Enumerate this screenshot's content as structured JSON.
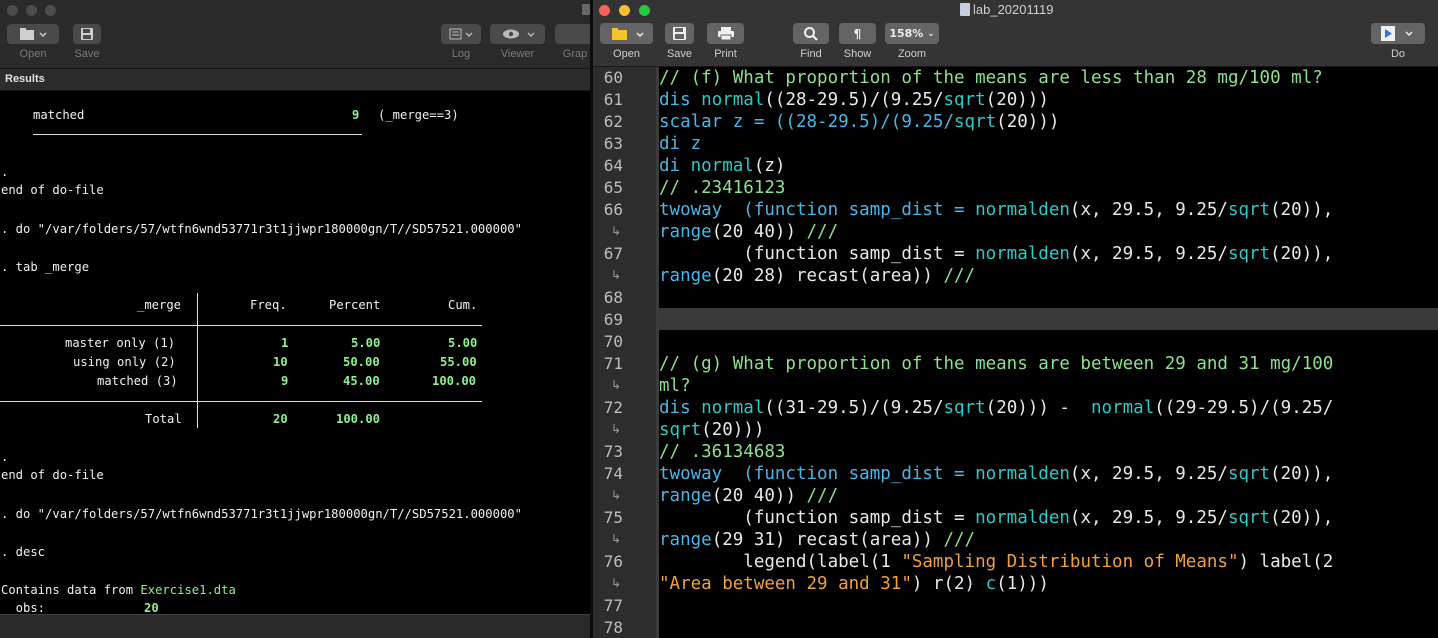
{
  "results_window": {
    "toolbar": [
      {
        "id": "open",
        "label": "Open"
      },
      {
        "id": "save",
        "label": "Save"
      },
      {
        "id": "log",
        "label": "Log"
      },
      {
        "id": "viewer",
        "label": "Viewer"
      },
      {
        "id": "graph",
        "label": "Grap"
      }
    ],
    "header_title": "Results",
    "output": {
      "matched_line": {
        "label": "matched",
        "count": "9",
        "cond": "(_merge==3)"
      },
      "dot1": ".",
      "end1": "end of do-file",
      "do1": ". do \"/var/folders/57/wtfn6wnd53771r3t1jjwpr180000gn/T//SD57521.000000\"",
      "tab_cmd": ". tab _merge",
      "table": {
        "headers": [
          "_merge",
          "Freq.",
          "Percent",
          "Cum."
        ],
        "rows": [
          {
            "label": "master only (1)",
            "freq": "1",
            "pct": "5.00",
            "cum": "5.00"
          },
          {
            "label": "using only (2)",
            "freq": "10",
            "pct": "50.00",
            "cum": "55.00"
          },
          {
            "label": "matched (3)",
            "freq": "9",
            "pct": "45.00",
            "cum": "100.00"
          }
        ],
        "total": {
          "label": "Total",
          "freq": "20",
          "pct": "100.00"
        }
      },
      "dot2": ".",
      "end2": "end of do-file",
      "do2": ". do \"/var/folders/57/wtfn6wnd53771r3t1jjwpr180000gn/T//SD57521.000000\"",
      "desc_cmd": ". desc",
      "contains_prefix": "Contains data from ",
      "contains_file": "Exercise1.dta",
      "obs_label": "  obs:",
      "obs_value": "20"
    }
  },
  "editor_window": {
    "title": "lab_20201119",
    "toolbar": [
      {
        "id": "open",
        "label": "Open"
      },
      {
        "id": "save",
        "label": "Save"
      },
      {
        "id": "print",
        "label": "Print"
      },
      {
        "id": "find",
        "label": "Find"
      },
      {
        "id": "show",
        "label": "Show"
      },
      {
        "id": "zoom",
        "label": "Zoom",
        "value": "158%"
      },
      {
        "id": "do",
        "label": "Do"
      }
    ],
    "line_numbers": [
      "60",
      "61",
      "62",
      "63",
      "64",
      "65",
      "66",
      "67",
      "68",
      "69",
      "70",
      "71",
      "72",
      "73",
      "74",
      "75",
      "76",
      "77",
      "78"
    ],
    "code": {
      "l60": "// (f) What proportion of the means are less than 28 mg/100 ml?",
      "l61": {
        "a": "dis ",
        "b": "normal",
        "c": "((28-29.5)/(9.25/",
        "d": "sqrt",
        "e": "(20)))"
      },
      "l62": {
        "a": "scalar z = ((28-29.5)/(9.25/",
        "b": "sqrt",
        "c": "(20)))"
      },
      "l63": "di z",
      "l64": {
        "a": "di ",
        "b": "normal",
        "c": "(z)"
      },
      "l65": "// .23416123",
      "l66a": {
        "a": "twoway  (function samp_dist = ",
        "b": "normalden",
        "c": "(x, 29.5, 9.25/",
        "d": "sqrt",
        "e": "(20)),"
      },
      "l66b": {
        "a": "range",
        "b": "(20 40)) ",
        "c": "///"
      },
      "l67a": {
        "a": "        (function samp_dist = ",
        "b": "normalden",
        "c": "(x, 29.5, 9.25/",
        "d": "sqrt",
        "e": "(20)),"
      },
      "l67b": {
        "a": "range",
        "b": "(20 28) recast(area)) ",
        "c": "///"
      },
      "l71a": "// (g) What proportion of the means are between 29 and 31 mg/100",
      "l71b": "ml?",
      "l72a": {
        "a": "dis ",
        "b": "normal",
        "c": "((31-29.5)/(9.25/",
        "d": "sqrt",
        "e": "(20))) -  ",
        "f": "normal",
        "g": "((29-29.5)/(9.25/"
      },
      "l72b": {
        "a": "sqrt",
        "b": "(20)))"
      },
      "l73": "// .36134683",
      "l74a": {
        "a": "twoway  (function samp_dist = ",
        "b": "normalden",
        "c": "(x, 29.5, 9.25/",
        "d": "sqrt",
        "e": "(20)),"
      },
      "l74b": {
        "a": "range",
        "b": "(20 40)) ",
        "c": "///"
      },
      "l75a": {
        "a": "        (function samp_dist = ",
        "b": "normalden",
        "c": "(x, 29.5, 9.25/",
        "d": "sqrt",
        "e": "(20)),"
      },
      "l75b": {
        "a": "range",
        "b": "(29 31) recast(area)) ",
        "c": "///"
      },
      "l76a": {
        "a": "        legend(label(1 ",
        "b": "\"Sampling Distribution of Means\"",
        "c": ") label(2"
      },
      "l76b": {
        "a": "\"Area between 29 and 31\"",
        "b": ") r(2) ",
        "c": "c",
        "d": "(1)))"
      }
    },
    "wrap_marker": "↳"
  }
}
